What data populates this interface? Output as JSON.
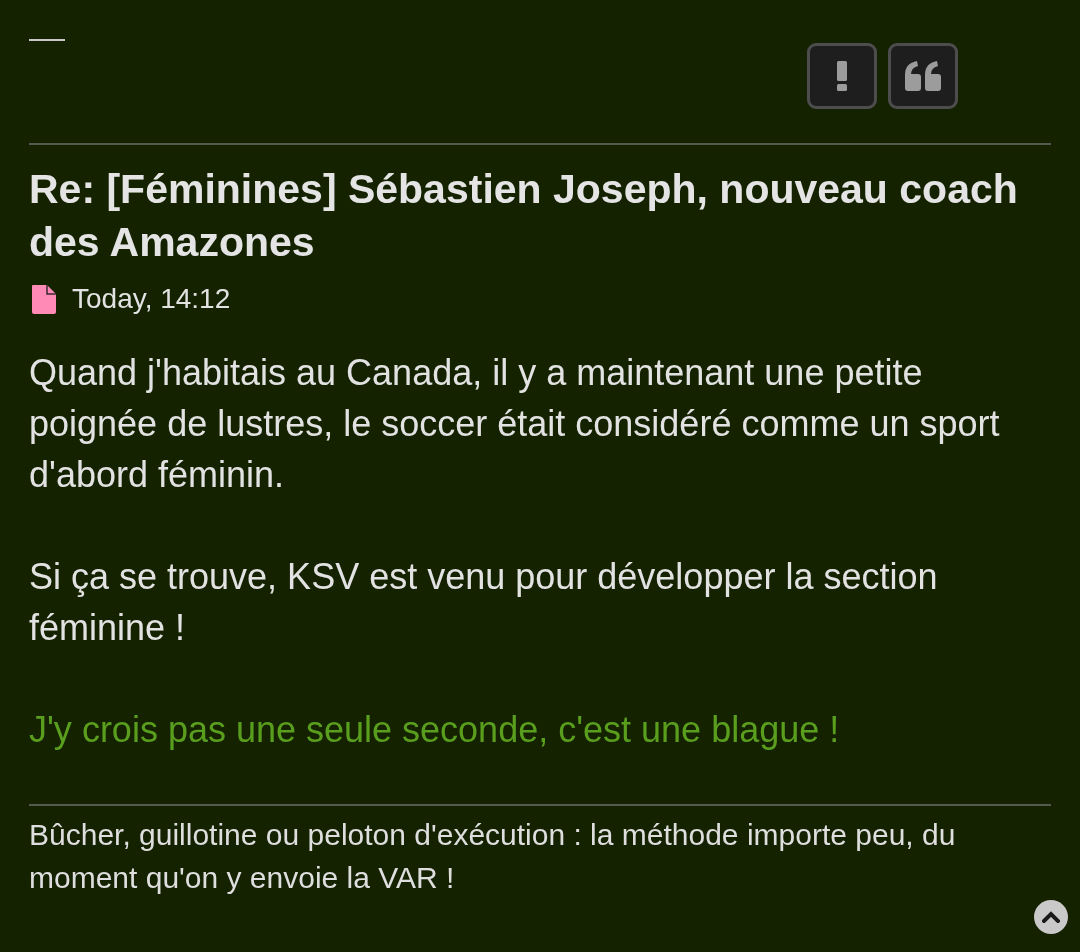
{
  "post_buttons": [
    {
      "kind": "report"
    },
    {
      "kind": "quote"
    }
  ],
  "post": {
    "title": "Re: [Féminines] Sébastien Joseph, nouveau coach des Amazones",
    "date": "Today, 14:12",
    "paragraphs": [
      {
        "text": "Quand j'habitais au Canada, il y a maintenant une petite poignée de lustres, le soccer était considéré comme un sport d'abord féminin.",
        "color": "#e2e2e2"
      },
      {
        "text": "Si ça se trouve, KSV est venu pour développer la section féminine !",
        "color": "#e2e2e2"
      },
      {
        "text": "J'y crois pas une seule seconde, c'est une blague !",
        "color": "#5a9e1e"
      }
    ],
    "signature": "Bûcher, guillotine ou peloton d'exécution : la méthode importe peu, du moment qu'on y envoie la VAR !"
  }
}
